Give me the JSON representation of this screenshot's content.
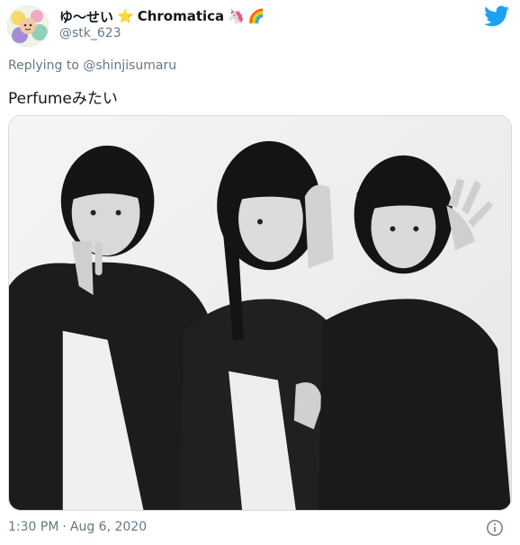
{
  "user": {
    "display_name": "ゆ〜せい",
    "display_name_suffix": "Chromatica",
    "emoji_star": "⭐",
    "emoji_unicorn": "🦄",
    "emoji_rainbow": "🌈",
    "handle": "@stk_623"
  },
  "reply": {
    "prefix": "Replying to",
    "mention": "@shinjisumaru"
  },
  "tweet": {
    "text": "Perfumeみたい"
  },
  "footer": {
    "time": "1:30 PM",
    "separator": "·",
    "date": "Aug 6, 2020"
  },
  "icons": {
    "brand": "twitter-bird-icon",
    "info": "info-icon",
    "accent_color": "#1da1f2"
  }
}
